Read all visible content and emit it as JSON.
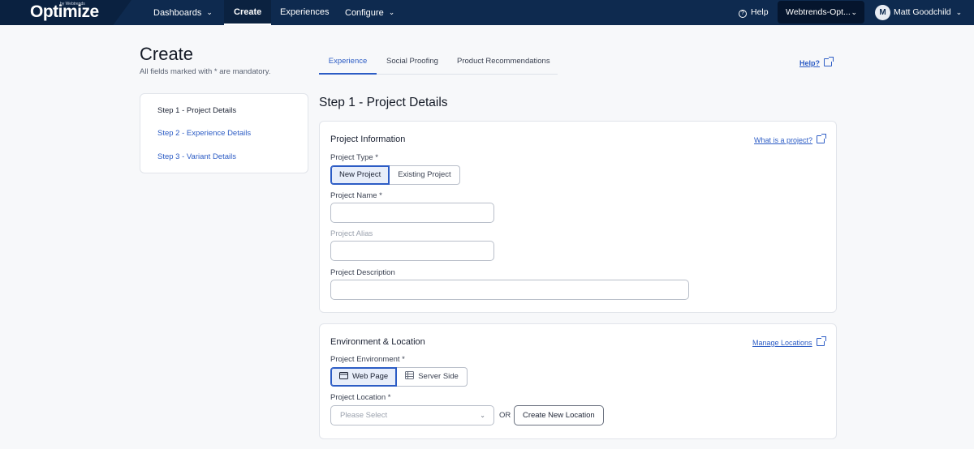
{
  "topbar": {
    "logo": "Optimize",
    "logo_small": "by Webtrends",
    "nav": [
      {
        "label": "Dashboards",
        "chevron": true
      },
      {
        "label": "Create",
        "chevron": false
      },
      {
        "label": "Experiences",
        "chevron": false
      },
      {
        "label": "Configure",
        "chevron": true
      }
    ],
    "help": "Help",
    "account": "Webtrends-Opt...",
    "user_initial": "M",
    "user_name": "Matt Goodchild"
  },
  "header": {
    "title": "Create",
    "mandatory_note": "All fields marked with * are mandatory.",
    "tabs": [
      "Experience",
      "Social Proofing",
      "Product Recommendations"
    ],
    "active_tab": "Experience",
    "help_link": "Help?"
  },
  "steps": [
    {
      "label": "Step 1 - Project Details",
      "state": "current"
    },
    {
      "label": "Step 2 - Experience Details",
      "state": "link"
    },
    {
      "label": "Step 3 - Variant Details",
      "state": "link"
    }
  ],
  "section_title": "Step 1 - Project Details",
  "project_info": {
    "title": "Project Information",
    "link": "What is a project?",
    "type_label": "Project Type *",
    "type_options": [
      "New Project",
      "Existing Project"
    ],
    "type_selected": "New Project",
    "name_label": "Project Name *",
    "name_value": "",
    "alias_label": "Project Alias",
    "alias_value": "",
    "description_label": "Project Description",
    "description_value": ""
  },
  "environment": {
    "title": "Environment & Location",
    "link": "Manage Locations",
    "env_label": "Project Environment *",
    "env_options": [
      {
        "label": "Web Page",
        "icon": "browser-window-icon"
      },
      {
        "label": "Server Side",
        "icon": "server-icon"
      }
    ],
    "env_selected": "Web Page",
    "location_label": "Project Location *",
    "location_placeholder": "Please Select",
    "or_text": "OR",
    "create_location_button": "Create New Location"
  },
  "colors": {
    "topbar_bg": "#0e2a4f",
    "accent": "#2c5cc5",
    "page_bg": "#f7f8fa"
  }
}
